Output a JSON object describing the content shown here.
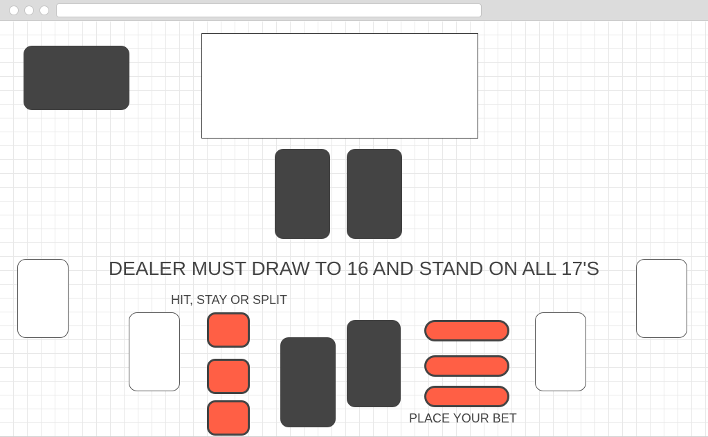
{
  "table": {
    "rule_text": "DEALER MUST DRAW TO 16 AND STAND ON ALL 17'S",
    "action_prompt": "HIT, STAY OR SPLIT",
    "bet_prompt": "PLACE YOUR BET"
  },
  "colors": {
    "card": "#444444",
    "button_fill": "#ff5f45",
    "button_border": "#444444",
    "text": "#444444",
    "grid": "#e8e8e8"
  },
  "controls": {
    "action_buttons": 3,
    "bet_buttons": 3
  }
}
